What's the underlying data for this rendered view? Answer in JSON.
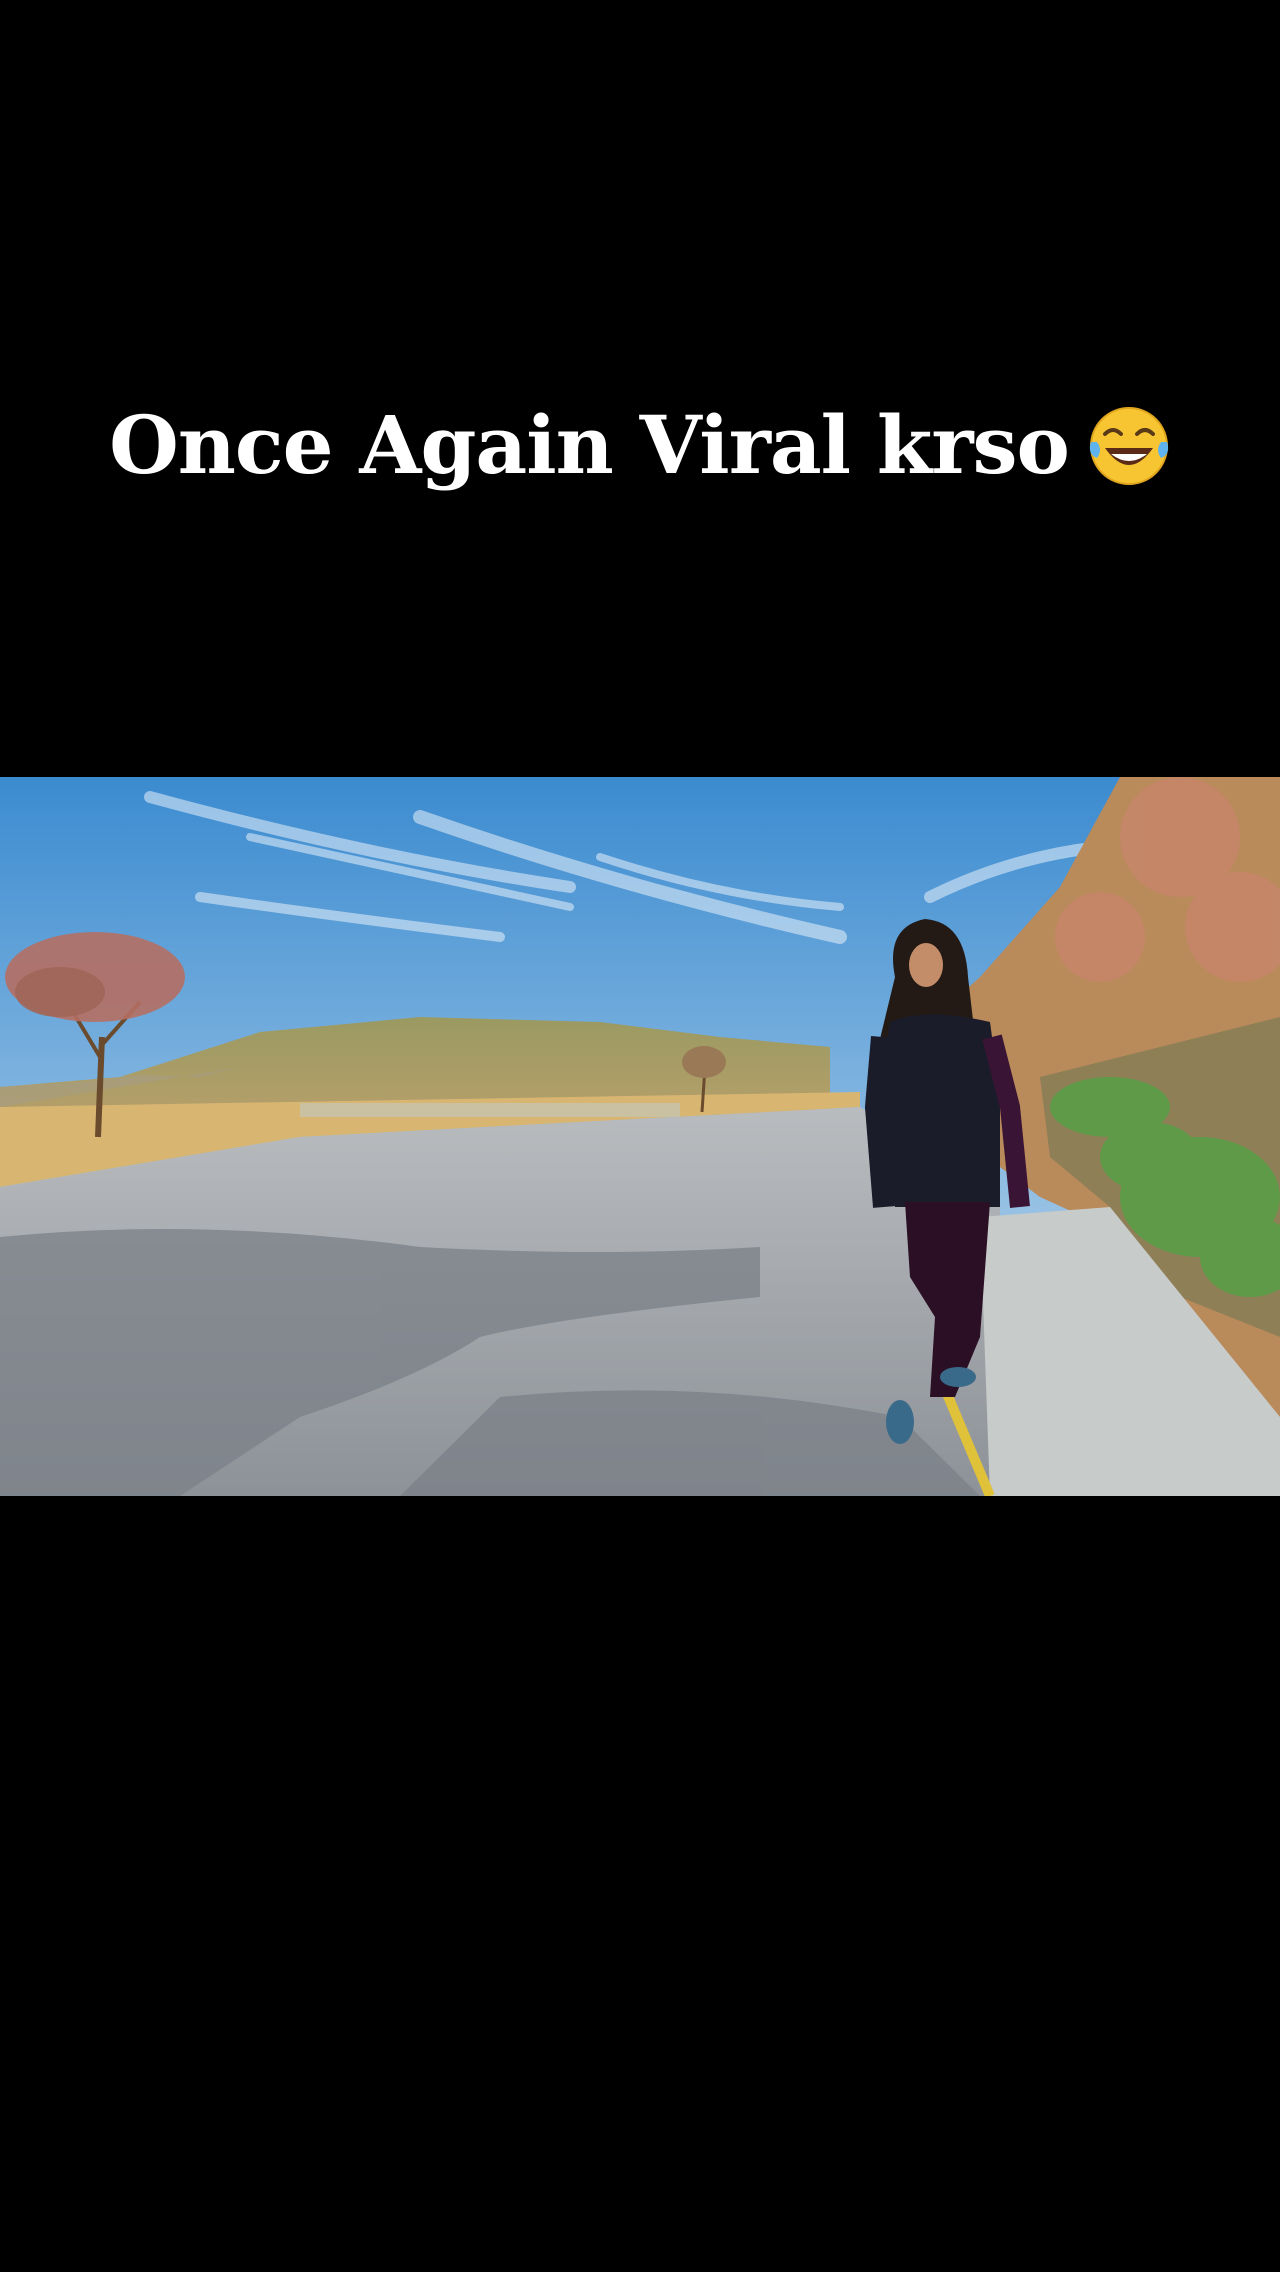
{
  "caption": {
    "text": "Once Again Viral krso",
    "emoji": "face-with-tears-of-joy-icon"
  },
  "colors": {
    "background": "#000000",
    "caption_text": "#ffffff",
    "sky_top": "#3f8fd3",
    "sky_bottom": "#b7d4ea",
    "road": "#9aa0a6",
    "road_edge_line": "#e0c23a",
    "vegetation": "#5f9a4a"
  }
}
